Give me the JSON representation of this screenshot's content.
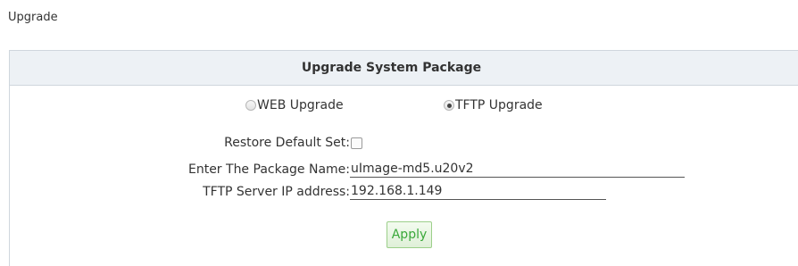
{
  "page": {
    "title": "Upgrade"
  },
  "panel": {
    "title": "Upgrade System Package",
    "upgrade_modes": [
      {
        "label": "WEB Upgrade",
        "checked": false
      },
      {
        "label": "TFTP Upgrade",
        "checked": true
      }
    ],
    "fields": {
      "restore_default": {
        "label": "Restore Default Set:",
        "checked": false
      },
      "package_name": {
        "label": "Enter The Package Name:",
        "value": "uImage-md5.u20v2"
      },
      "tftp_server_ip": {
        "label": "TFTP Server IP address:",
        "value": "192.168.1.149"
      }
    },
    "apply_label": "Apply"
  },
  "colors": {
    "header_bg": "#edf1f5",
    "border": "#cfd6dd",
    "apply_text": "#3aa83a",
    "apply_border": "#9ccf8a"
  }
}
